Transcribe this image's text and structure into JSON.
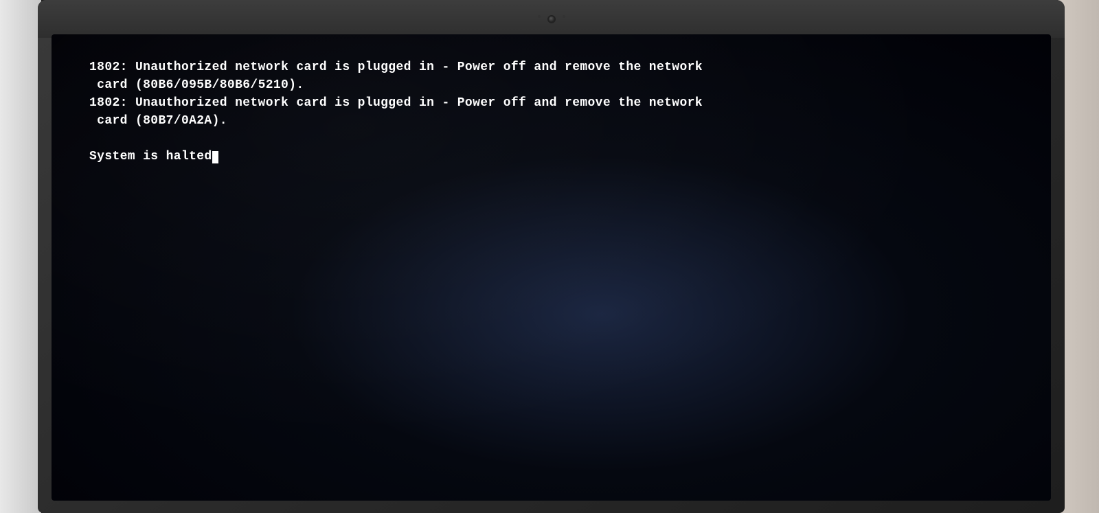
{
  "monitor": {
    "screen": {
      "background_color": "#000005"
    }
  },
  "terminal": {
    "lines": [
      {
        "id": "line1",
        "text": "1802: Unauthorized network card is plugged in - Power off and remove the network"
      },
      {
        "id": "line2",
        "text": " card (80B6/095B/80B6/5210)."
      },
      {
        "id": "line3",
        "text": "1802: Unauthorized network card is plugged in - Power off and remove the network"
      },
      {
        "id": "line4",
        "text": " card (80B7/0A2A)."
      },
      {
        "id": "line5",
        "text": ""
      },
      {
        "id": "line6",
        "text": "System is halted"
      }
    ]
  }
}
